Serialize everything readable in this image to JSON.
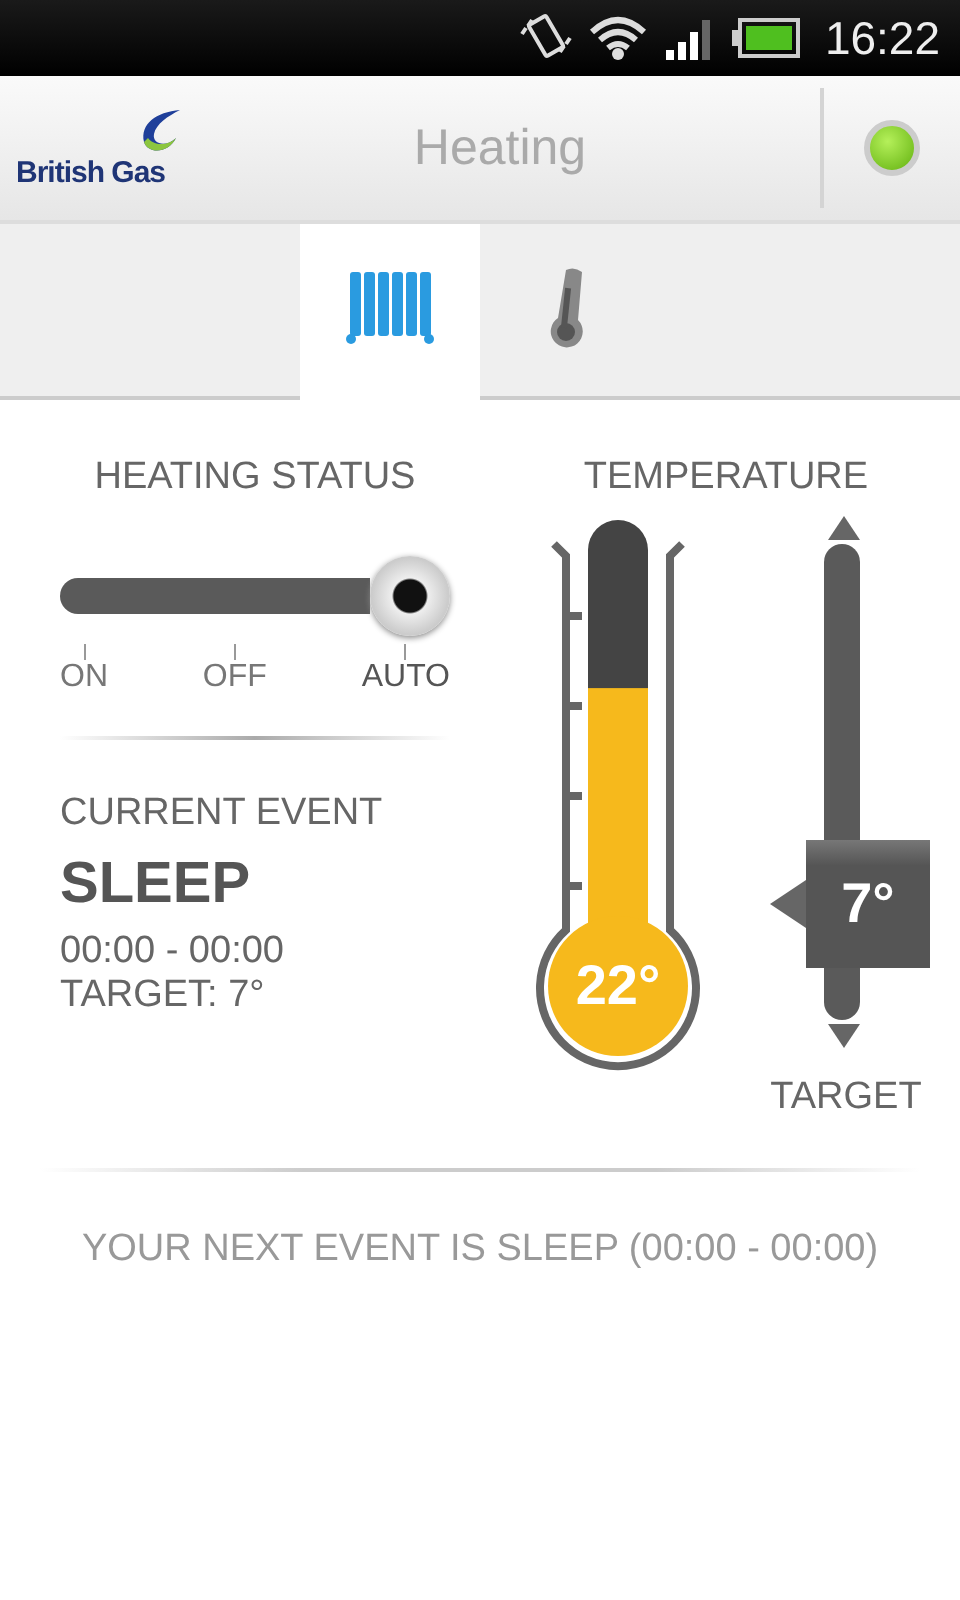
{
  "status_bar": {
    "time": "16:22"
  },
  "header": {
    "logo": "British Gas",
    "title": "Heating",
    "connected": true
  },
  "tabs": [
    {
      "kind": "radiator",
      "selected": true
    },
    {
      "kind": "thermometer",
      "selected": false
    }
  ],
  "heating_status": {
    "title": "HEATING STATUS",
    "options": [
      {
        "label": "ON",
        "selected": false
      },
      {
        "label": "OFF",
        "selected": false
      },
      {
        "label": "AUTO",
        "selected": true
      }
    ]
  },
  "current_event": {
    "heading": "CURRENT EVENT",
    "name": "SLEEP",
    "time": "00:00 - 00:00",
    "target": "TARGET: 7°"
  },
  "temperature": {
    "title": "TEMPERATURE",
    "reading": "22°",
    "level": 0.61,
    "target": {
      "value": "7°",
      "label": "TARGET"
    }
  },
  "next_event": "YOUR NEXT EVENT IS SLEEP (00:00 - 00:00)"
}
